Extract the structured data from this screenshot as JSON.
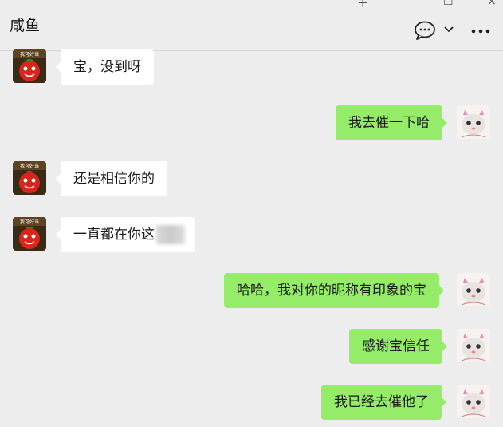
{
  "header": {
    "title": "咸鱼",
    "window_controls": [
      "＋",
      "☐",
      "×"
    ],
    "icons": [
      "chat-bubble-icon",
      "chevron-down-icon",
      "more-icon"
    ]
  },
  "messages": [
    {
      "side": "left",
      "text": "宝，没到呀"
    },
    {
      "side": "right",
      "text": "我去催一下哈"
    },
    {
      "side": "left",
      "text": "还是相信你的"
    },
    {
      "side": "left",
      "text": "一直都在你这",
      "redacted": true
    },
    {
      "side": "right",
      "text": "哈哈，我对你的昵称有印象的宝"
    },
    {
      "side": "right",
      "text": "感谢宝信任"
    },
    {
      "side": "right",
      "text": "我已经去催他了"
    }
  ],
  "colors": {
    "background": "#ededed",
    "bubble_self": "#95ec69",
    "bubble_other": "#ffffff"
  },
  "avatar_left_caption": "我可好当"
}
